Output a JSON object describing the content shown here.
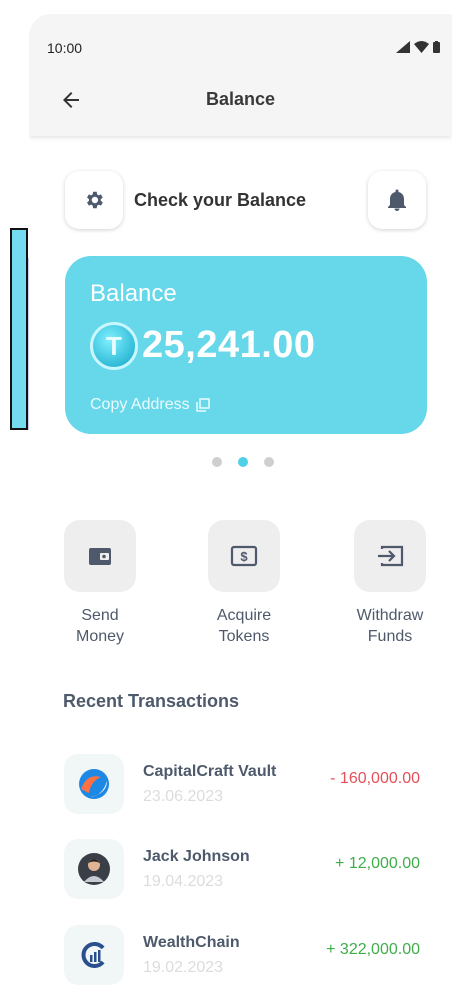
{
  "status": {
    "time": "10:00"
  },
  "header": {
    "title": "Balance"
  },
  "balance_section": {
    "title": "Check your Balance"
  },
  "card": {
    "label": "Balance",
    "coin_letter": "T",
    "amount": "25,241.00",
    "copy_label": "Copy Address",
    "color": "#67d7ea"
  },
  "pager": {
    "count": 3,
    "active_index": 1
  },
  "actions": [
    {
      "label_line1": "Send",
      "label_line2": "Money",
      "icon": "wallet-icon"
    },
    {
      "label_line1": "Acquire",
      "label_line2": "Tokens",
      "icon": "dollar-bill-icon"
    },
    {
      "label_line1": "Withdraw",
      "label_line2": "Funds",
      "icon": "withdraw-icon"
    }
  ],
  "recent": {
    "title": "Recent Transactions",
    "items": [
      {
        "name": "CapitalCraft Vault",
        "date": "23.06.2023",
        "amount": "- 160,000.00",
        "type": "debit",
        "icon": "capitalcraft-logo-icon"
      },
      {
        "name": "Jack Johnson",
        "date": "19.04.2023",
        "amount": "+ 12,000.00",
        "type": "credit",
        "icon": "person-avatar-icon"
      },
      {
        "name": "WealthChain",
        "date": "19.02.2023",
        "amount": "+ 322,000.00",
        "type": "credit",
        "icon": "wealthchain-logo-icon"
      }
    ]
  },
  "colors": {
    "negative": "#e5505a",
    "positive": "#3fae4a",
    "accent": "#4fcfe8"
  }
}
